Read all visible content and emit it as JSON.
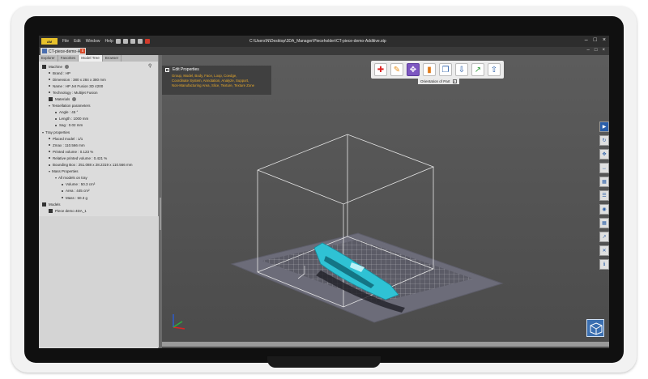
{
  "titlebar": {
    "logo": "AM",
    "menu": [
      "File",
      "Edit",
      "Window",
      "Help"
    ],
    "path": "C:\\Users\\N\\Desktop\\3DA_Manager\\Pieceholder\\CT-piece-demo-Additive.stp",
    "controls": [
      "–",
      "□",
      "×"
    ]
  },
  "document_tab": {
    "label": "CT-piece-demo-A...",
    "close": "x",
    "controls": [
      "–",
      "□",
      "×"
    ]
  },
  "panel": {
    "tabs": [
      "Explorer",
      "Favorites",
      "Model Tree",
      "Browser"
    ],
    "active_tab": "Model Tree",
    "tree": [
      {
        "label": "Machine",
        "level": 0,
        "kind": "icon",
        "badge": true
      },
      {
        "label": "Brand : HP",
        "level": 1,
        "kind": "dot"
      },
      {
        "label": "Dimension : 380 x 284 x 380 mm",
        "level": 1,
        "kind": "dot"
      },
      {
        "label": "Name : HP Jet Fusion 3D 4200",
        "level": 1,
        "kind": "dot"
      },
      {
        "label": "Technology : Multijet Fusion",
        "level": 1,
        "kind": "dot"
      },
      {
        "label": "Materials",
        "level": 1,
        "kind": "icon",
        "badge": true
      },
      {
        "label": "Tessellation parameters",
        "level": 1,
        "kind": "caret"
      },
      {
        "label": "Angle : 45 °",
        "level": 2,
        "kind": "dot"
      },
      {
        "label": "Length : 1000 mm",
        "level": 2,
        "kind": "dot"
      },
      {
        "label": "Sag : 0.02 mm",
        "level": 2,
        "kind": "dot"
      },
      {
        "label": "Tray properties",
        "level": 0,
        "kind": "caret"
      },
      {
        "label": "Placed model : 1/1",
        "level": 1,
        "kind": "dot"
      },
      {
        "label": "Zmax : 110.566 mm",
        "level": 1,
        "kind": "dot"
      },
      {
        "label": "Printed volume : 0.123  %",
        "level": 1,
        "kind": "dot"
      },
      {
        "label": "Relative printed volume : 0.421  %",
        "level": 1,
        "kind": "dot"
      },
      {
        "label": "Bounding Box : 251.088 x 28.2319 x 110.566 mm",
        "level": 1,
        "kind": "dot"
      },
      {
        "label": "Mass Properties",
        "level": 1,
        "kind": "caret"
      },
      {
        "label": "All models on tray",
        "level": 2,
        "kind": "caret"
      },
      {
        "label": "Volume : 50.3 cm³",
        "level": 3,
        "kind": "dot"
      },
      {
        "label": "Area : 445 cm²",
        "level": 3,
        "kind": "dot"
      },
      {
        "label": "Mass : 50.3 g",
        "level": 3,
        "kind": "dot"
      },
      {
        "label": "Models",
        "level": 0,
        "kind": "icon"
      },
      {
        "label": "Piece demo 4DA_1",
        "level": 1,
        "kind": "icon-small"
      }
    ]
  },
  "properties": {
    "title": "Edit Properties",
    "links_line1": "Group, Model, Body, Face, Loop, Coedge,",
    "links_line2": "Coordinate System, Annotation, Analyze, Support,",
    "links_line3": "Non-Manufacturing Area, Slice, Texture, Texture Zone"
  },
  "toolbar": {
    "buttons": [
      "add",
      "edit",
      "orientation",
      "chart",
      "copy",
      "download",
      "export",
      "upload"
    ],
    "active": "orientation",
    "tooltip": "Orientation of Part"
  },
  "right_toolbar": [
    "pointer",
    "rotate",
    "move",
    "measure",
    "section",
    "layers",
    "view",
    "grid",
    "export",
    "close",
    "info"
  ],
  "colors": {
    "accent_purple": "#7d57c1",
    "part_cyan": "#2fc2d4",
    "link_orange": "#e8a92a",
    "viewport_gray": "#5b5b5b",
    "tray_gray": "#6a6a78"
  }
}
